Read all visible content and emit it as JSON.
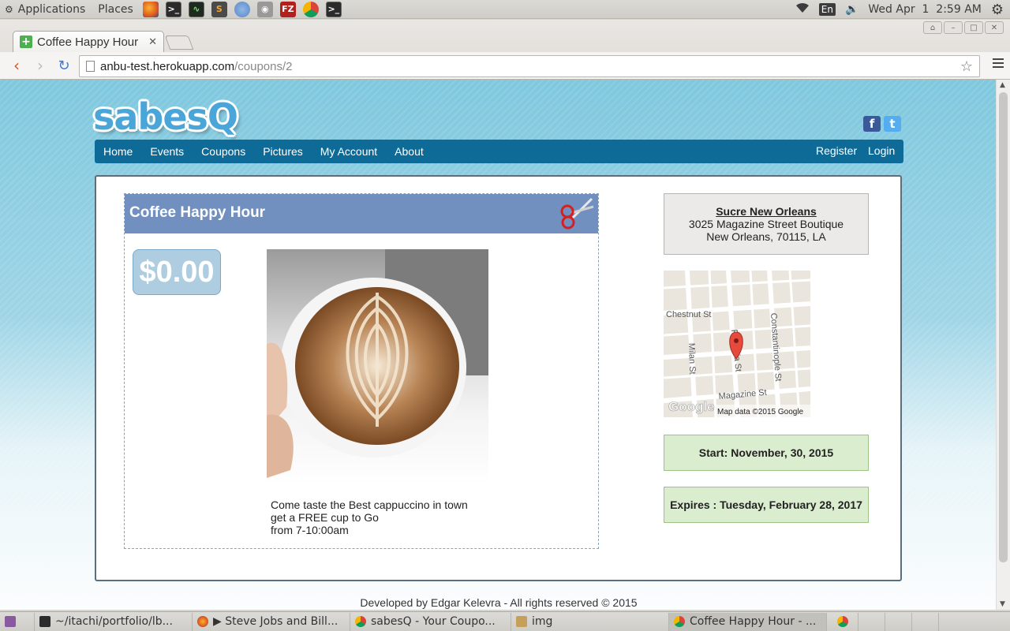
{
  "system": {
    "applications": "Applications",
    "places": "Places",
    "keyboard": "En",
    "clock": "Wed Apr  1  2:59 AM"
  },
  "browser": {
    "tab_title": "Coffee Happy Hour",
    "url_host": "anbu-test.herokuapp.com",
    "url_path": "/coupons/2"
  },
  "site": {
    "logo": "sabesQ",
    "nav": [
      "Home",
      "Events",
      "Coupons",
      "Pictures",
      "My Account",
      "About"
    ],
    "nav_right": [
      "Register",
      "Login"
    ],
    "social": [
      "facebook-icon",
      "twitter-icon"
    ]
  },
  "coupon": {
    "title": "Coffee Happy Hour",
    "price": "$0.00",
    "description": [
      "Come taste the Best cappuccino in town",
      "get a FREE cup to Go",
      "from 7-10:00am"
    ]
  },
  "business": {
    "name": "Sucre New Orleans",
    "street": "3025 Magazine Street Boutique",
    "city": "New Orleans, 70115, LA"
  },
  "map": {
    "streets": [
      "Chestnut St",
      "Milan St",
      "Prytania St",
      "Constantinople St",
      "Magazine St"
    ],
    "attribution": "Map data ©2015 Google",
    "provider": "Google"
  },
  "dates": {
    "start": "Start: November, 30, 2015",
    "expires": "Expires : Tuesday, February 28, 2017"
  },
  "footer": "Developed by Edgar Kelevra - All rights reserved © 2015",
  "taskbar": [
    {
      "label": "~/itachi/portfolio/lb...",
      "icon": "terminal-icon"
    },
    {
      "label": "▶ Steve Jobs and Bill...",
      "icon": "firefox-icon"
    },
    {
      "label": "sabesQ - Your Coupo...",
      "icon": "chrome-icon"
    },
    {
      "label": "img",
      "icon": "image-viewer-icon"
    },
    {
      "label": "Coffee Happy Hour - ...",
      "icon": "chrome-icon"
    }
  ]
}
